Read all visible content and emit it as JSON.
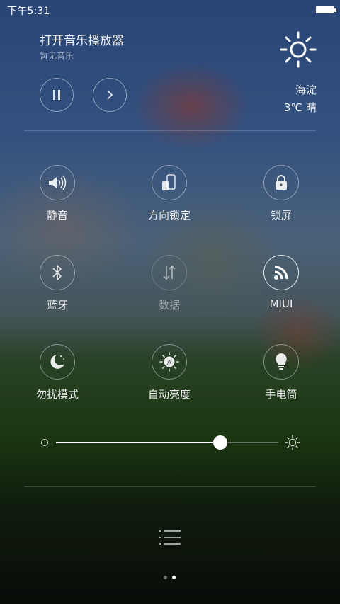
{
  "status_bar": {
    "time": "下午5:31"
  },
  "music": {
    "title": "打开音乐播放器",
    "subtitle": "暂无音乐",
    "buttons": [
      "pause-icon",
      "next-icon"
    ]
  },
  "weather": {
    "icon": "sun-icon",
    "city": "海淀",
    "temp_desc": "3℃  晴"
  },
  "toggles": [
    {
      "label": "静音",
      "icon": "speaker-icon",
      "state": "on"
    },
    {
      "label": "方向锁定",
      "icon": "rotation-lock-icon",
      "state": "on"
    },
    {
      "label": "锁屏",
      "icon": "lock-icon",
      "state": "on"
    },
    {
      "label": "蓝牙",
      "icon": "bluetooth-icon",
      "state": "on"
    },
    {
      "label": "数据",
      "icon": "mobile-data-icon",
      "state": "disabled"
    },
    {
      "label": "MIUI",
      "icon": "wifi-icon",
      "state": "active"
    },
    {
      "label": "勿扰模式",
      "icon": "moon-icon",
      "state": "on"
    },
    {
      "label": "自动亮度",
      "icon": "auto-brightness-icon",
      "state": "on"
    },
    {
      "label": "手电筒",
      "icon": "flashlight-icon",
      "state": "on"
    }
  ],
  "brightness": {
    "value_fraction": 0.74
  },
  "pager": {
    "current": 2,
    "total": 2
  },
  "colors": {
    "accent": "#ffffff",
    "active_ring": "#ffffff"
  }
}
